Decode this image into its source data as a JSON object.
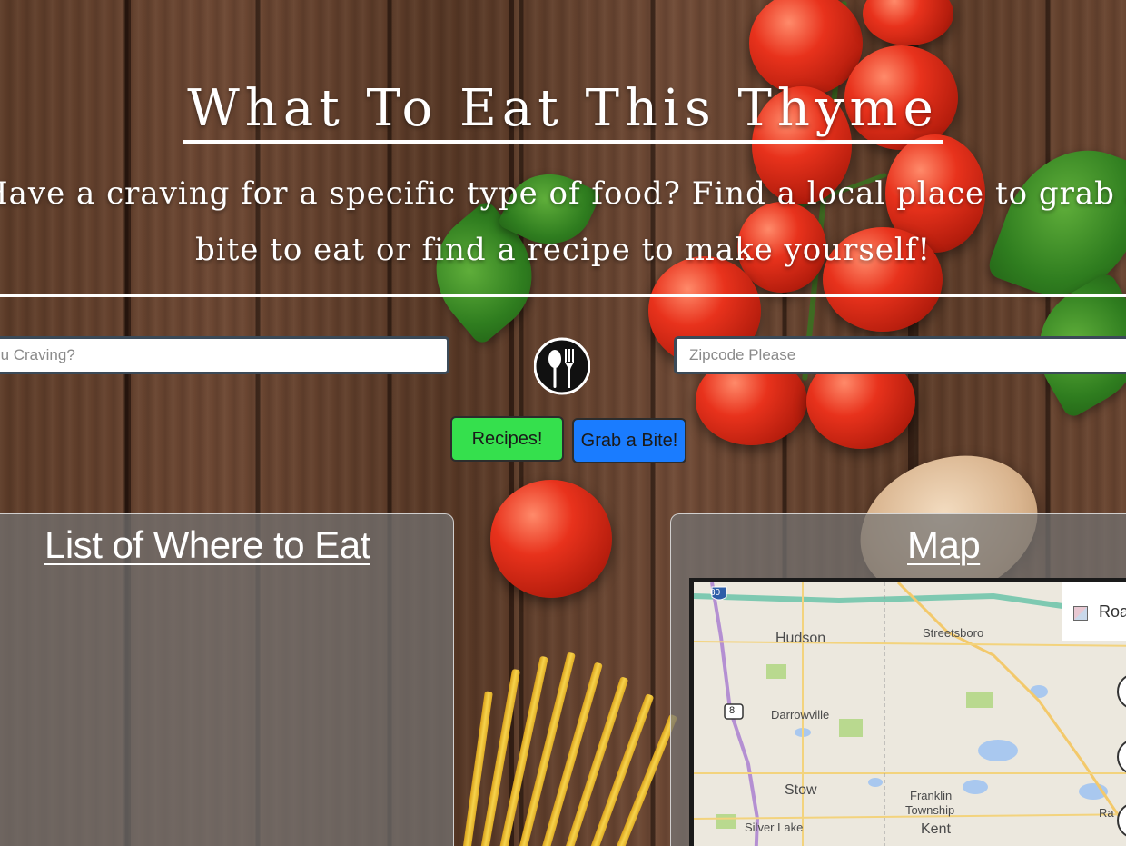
{
  "header": {
    "title": "What To Eat This Thyme",
    "subtitle": "Have a craving for a specific type of food? Find a local place to grab a bite to eat or find a recipe to make yourself!"
  },
  "search": {
    "craving_placeholder": "What Are You Craving?",
    "zip_placeholder": "Zipcode Please"
  },
  "buttons": {
    "recipes_label": "Recipes!",
    "grab_label": "Grab a Bite!"
  },
  "panels": {
    "list_title": "List of Where to Eat",
    "map_title": "Map"
  },
  "map": {
    "legend_label": "Road",
    "places": [
      "Hudson",
      "Streetsboro",
      "Darrowville",
      "Stow",
      "Franklin",
      "Township",
      "Silver Lake",
      "Kent",
      "Ra"
    ],
    "highway_shields": [
      "80",
      "8"
    ]
  },
  "colors": {
    "recipes_button": "#35e04d",
    "grab_button": "#1a7cff",
    "panel_bg": "#737373"
  },
  "icons": {
    "logo": "spoon-fork-icon"
  }
}
